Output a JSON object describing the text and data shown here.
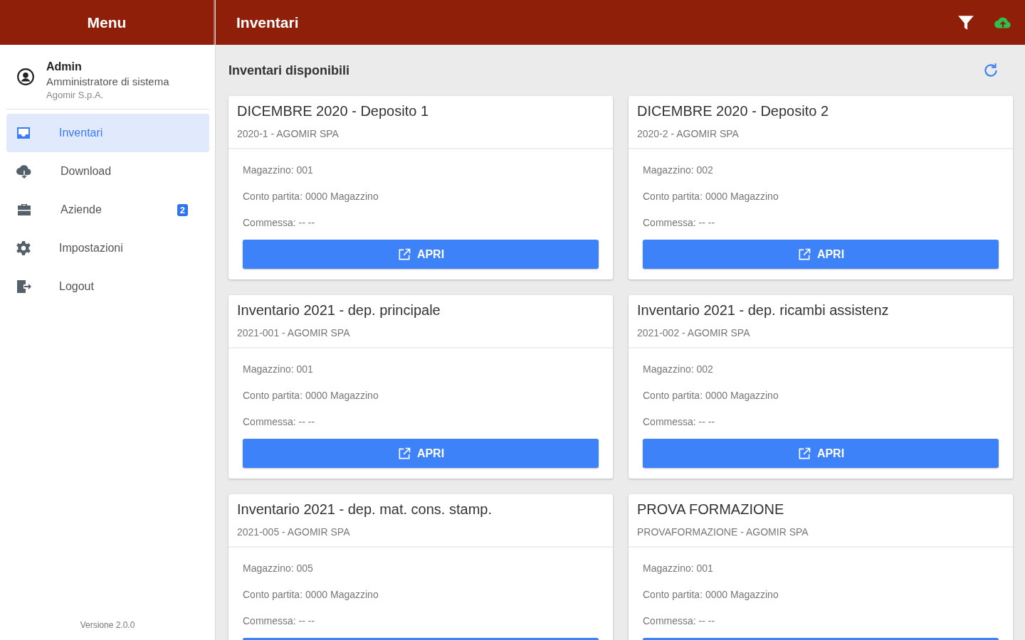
{
  "sidebar": {
    "title": "Menu",
    "user": {
      "name": "Admin",
      "role": "Amministratore di sistema",
      "company": "Agomir S.p.A."
    },
    "items": [
      {
        "label": "Inventari",
        "selected": true
      },
      {
        "label": "Download",
        "selected": false
      },
      {
        "label": "Aziende",
        "selected": false,
        "badge": "2"
      },
      {
        "label": "Impostazioni",
        "selected": false
      },
      {
        "label": "Logout",
        "selected": false
      }
    ],
    "version": "Versione 2.0.0"
  },
  "header": {
    "title": "Inventari"
  },
  "section_title": "Inventari disponibili",
  "cards": [
    {
      "title": "DICEMBRE 2020 - Deposito 1",
      "subtitle": "2020-1 - AGOMIR SPA",
      "details": [
        "Magazzino: 001",
        "Conto partita: 0000 Magazzino",
        "Commessa: -- --"
      ],
      "button": "APRI"
    },
    {
      "title": "DICEMBRE 2020 - Deposito 2",
      "subtitle": "2020-2 - AGOMIR SPA",
      "details": [
        "Magazzino: 002",
        "Conto partita: 0000 Magazzino",
        "Commessa: -- --"
      ],
      "button": "APRI"
    },
    {
      "title": "Inventario 2021 - dep. principale",
      "subtitle": "2021-001 - AGOMIR SPA",
      "details": [
        "Magazzino: 001",
        "Conto partita: 0000 Magazzino",
        "Commessa: -- --"
      ],
      "button": "APRI"
    },
    {
      "title": "Inventario 2021 - dep. ricambi assistenz",
      "subtitle": "2021-002 - AGOMIR SPA",
      "details": [
        "Magazzino: 002",
        "Conto partita: 0000 Magazzino",
        "Commessa: -- --"
      ],
      "button": "APRI"
    },
    {
      "title": "Inventario 2021 - dep. mat. cons. stamp.",
      "subtitle": "2021-005 - AGOMIR SPA",
      "details": [
        "Magazzino: 005",
        "Conto partita: 0000 Magazzino",
        "Commessa: -- --"
      ]
    },
    {
      "title": "PROVA FORMAZIONE",
      "subtitle": "PROVAFORMAZIONE - AGOMIR SPA",
      "details": [
        "Magazzino: 001",
        "Conto partita: 0000 Magazzino",
        "Commessa: -- --"
      ]
    }
  ]
}
